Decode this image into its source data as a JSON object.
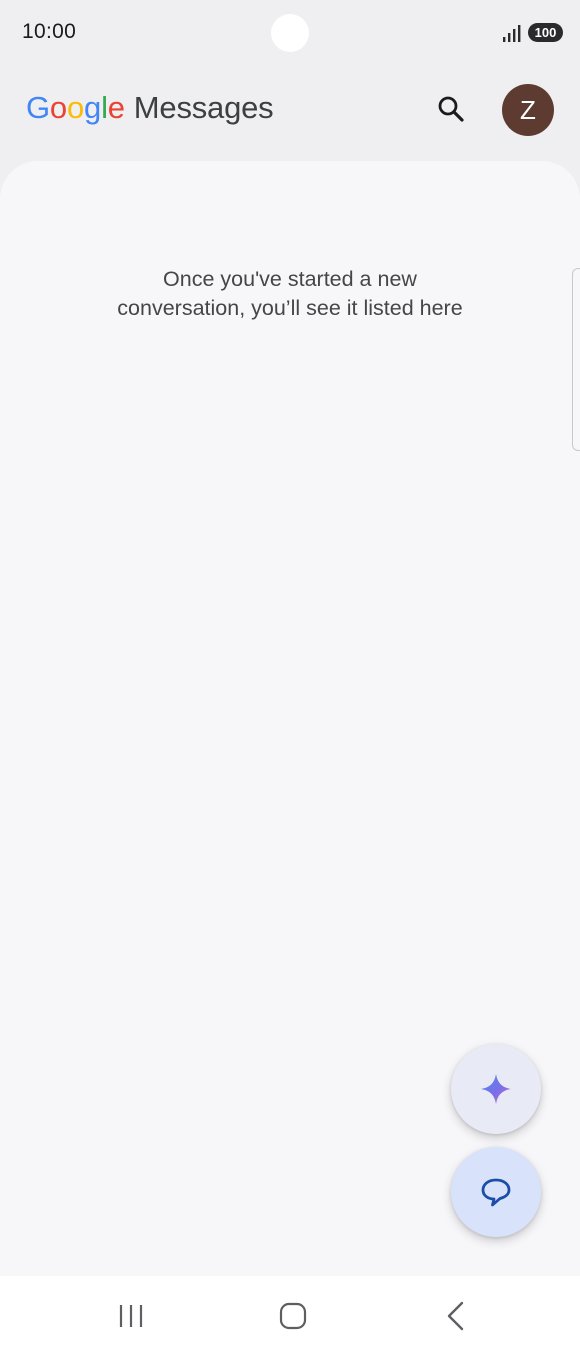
{
  "status_bar": {
    "time": "10:00",
    "battery": "100",
    "icons": [
      "signal-icon",
      "battery-icon"
    ]
  },
  "header": {
    "logo_letters": [
      "G",
      "o",
      "o",
      "g",
      "l",
      "e"
    ],
    "app_name": "Messages",
    "search_icon": "search-icon",
    "avatar_initial": "Z",
    "avatar_color": "#5d3b31"
  },
  "main": {
    "empty_line1": "Once you've started a new",
    "empty_line2": "conversation, you’ll see it listed here"
  },
  "fabs": {
    "gemini_icon": "sparkle-icon",
    "compose_icon": "chat-bubble-icon"
  },
  "nav": {
    "icons": [
      "recents-icon",
      "home-icon",
      "back-icon"
    ]
  },
  "colors": {
    "background": "#efeff1",
    "content": "#f7f7f9",
    "compose_fab": "#d8e3fb",
    "accent": "#1a4ea8"
  }
}
